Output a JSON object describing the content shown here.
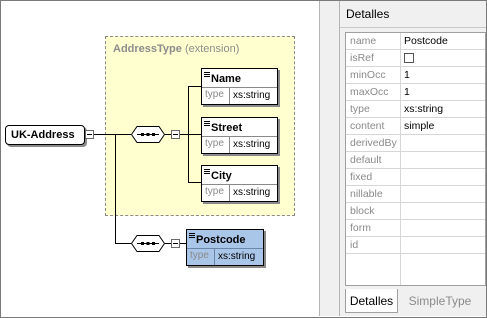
{
  "diagram": {
    "root_element": "UK-Address",
    "complex_type": {
      "name": "AddressType",
      "kind": "(extension)"
    },
    "extension_elements": [
      {
        "name": "Name",
        "type_label": "type",
        "type_value": "xs:string"
      },
      {
        "name": "Street",
        "type_label": "type",
        "type_value": "xs:string"
      },
      {
        "name": "City",
        "type_label": "type",
        "type_value": "xs:string"
      }
    ],
    "selected_element": {
      "name": "Postcode",
      "type_label": "type",
      "type_value": "xs:string"
    }
  },
  "details_panel": {
    "title": "Detalles",
    "properties": [
      {
        "key": "name",
        "value": "Postcode"
      },
      {
        "key": "isRef",
        "value": "",
        "control": "checkbox",
        "checked": false
      },
      {
        "key": "minOcc",
        "value": "1"
      },
      {
        "key": "maxOcc",
        "value": "1"
      },
      {
        "key": "type",
        "value": "xs:string"
      },
      {
        "key": "content",
        "value": "simple"
      },
      {
        "key": "derivedBy",
        "value": ""
      },
      {
        "key": "default",
        "value": ""
      },
      {
        "key": "fixed",
        "value": ""
      },
      {
        "key": "nillable",
        "value": ""
      },
      {
        "key": "block",
        "value": ""
      },
      {
        "key": "form",
        "value": ""
      },
      {
        "key": "id",
        "value": ""
      }
    ],
    "tabs": [
      {
        "label": "Detalles",
        "active": true
      },
      {
        "label": "SimpleType",
        "active": false
      }
    ]
  },
  "colors": {
    "extension_fill": "#ffffcf",
    "selected_fill": "#a9c5e8"
  }
}
